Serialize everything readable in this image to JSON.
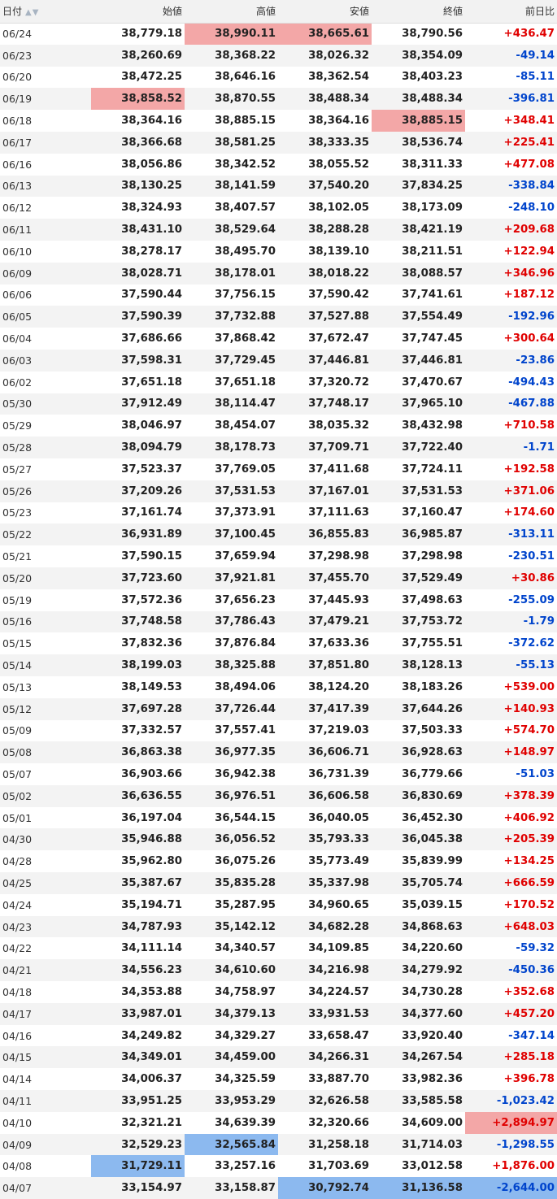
{
  "table": {
    "headers": {
      "date": "日付",
      "open": "始値",
      "high": "高値",
      "low": "安値",
      "close": "終値",
      "change": "前日比"
    },
    "sort_icon": "sort-arrows-icon",
    "rows": [
      {
        "date": "06/24",
        "open": "38,779.18",
        "high": "38,990.11",
        "low": "38,665.61",
        "close": "38,790.56",
        "change": "+436.47",
        "dir": "up",
        "hl": {
          "high": "red",
          "low": "red"
        }
      },
      {
        "date": "06/23",
        "open": "38,260.69",
        "high": "38,368.22",
        "low": "38,026.32",
        "close": "38,354.09",
        "change": "-49.14",
        "dir": "down"
      },
      {
        "date": "06/20",
        "open": "38,472.25",
        "high": "38,646.16",
        "low": "38,362.54",
        "close": "38,403.23",
        "change": "-85.11",
        "dir": "down"
      },
      {
        "date": "06/19",
        "open": "38,858.52",
        "high": "38,870.55",
        "low": "38,488.34",
        "close": "38,488.34",
        "change": "-396.81",
        "dir": "down",
        "hl": {
          "open": "red"
        }
      },
      {
        "date": "06/18",
        "open": "38,364.16",
        "high": "38,885.15",
        "low": "38,364.16",
        "close": "38,885.15",
        "change": "+348.41",
        "dir": "up",
        "hl": {
          "close": "red"
        }
      },
      {
        "date": "06/17",
        "open": "38,366.68",
        "high": "38,581.25",
        "low": "38,333.35",
        "close": "38,536.74",
        "change": "+225.41",
        "dir": "up"
      },
      {
        "date": "06/16",
        "open": "38,056.86",
        "high": "38,342.52",
        "low": "38,055.52",
        "close": "38,311.33",
        "change": "+477.08",
        "dir": "up"
      },
      {
        "date": "06/13",
        "open": "38,130.25",
        "high": "38,141.59",
        "low": "37,540.20",
        "close": "37,834.25",
        "change": "-338.84",
        "dir": "down"
      },
      {
        "date": "06/12",
        "open": "38,324.93",
        "high": "38,407.57",
        "low": "38,102.05",
        "close": "38,173.09",
        "change": "-248.10",
        "dir": "down"
      },
      {
        "date": "06/11",
        "open": "38,431.10",
        "high": "38,529.64",
        "low": "38,288.28",
        "close": "38,421.19",
        "change": "+209.68",
        "dir": "up"
      },
      {
        "date": "06/10",
        "open": "38,278.17",
        "high": "38,495.70",
        "low": "38,139.10",
        "close": "38,211.51",
        "change": "+122.94",
        "dir": "up"
      },
      {
        "date": "06/09",
        "open": "38,028.71",
        "high": "38,178.01",
        "low": "38,018.22",
        "close": "38,088.57",
        "change": "+346.96",
        "dir": "up"
      },
      {
        "date": "06/06",
        "open": "37,590.44",
        "high": "37,756.15",
        "low": "37,590.42",
        "close": "37,741.61",
        "change": "+187.12",
        "dir": "up"
      },
      {
        "date": "06/05",
        "open": "37,590.39",
        "high": "37,732.88",
        "low": "37,527.88",
        "close": "37,554.49",
        "change": "-192.96",
        "dir": "down"
      },
      {
        "date": "06/04",
        "open": "37,686.66",
        "high": "37,868.42",
        "low": "37,672.47",
        "close": "37,747.45",
        "change": "+300.64",
        "dir": "up"
      },
      {
        "date": "06/03",
        "open": "37,598.31",
        "high": "37,729.45",
        "low": "37,446.81",
        "close": "37,446.81",
        "change": "-23.86",
        "dir": "down"
      },
      {
        "date": "06/02",
        "open": "37,651.18",
        "high": "37,651.18",
        "low": "37,320.72",
        "close": "37,470.67",
        "change": "-494.43",
        "dir": "down"
      },
      {
        "date": "05/30",
        "open": "37,912.49",
        "high": "38,114.47",
        "low": "37,748.17",
        "close": "37,965.10",
        "change": "-467.88",
        "dir": "down"
      },
      {
        "date": "05/29",
        "open": "38,046.97",
        "high": "38,454.07",
        "low": "38,035.32",
        "close": "38,432.98",
        "change": "+710.58",
        "dir": "up"
      },
      {
        "date": "05/28",
        "open": "38,094.79",
        "high": "38,178.73",
        "low": "37,709.71",
        "close": "37,722.40",
        "change": "-1.71",
        "dir": "down"
      },
      {
        "date": "05/27",
        "open": "37,523.37",
        "high": "37,769.05",
        "low": "37,411.68",
        "close": "37,724.11",
        "change": "+192.58",
        "dir": "up"
      },
      {
        "date": "05/26",
        "open": "37,209.26",
        "high": "37,531.53",
        "low": "37,167.01",
        "close": "37,531.53",
        "change": "+371.06",
        "dir": "up"
      },
      {
        "date": "05/23",
        "open": "37,161.74",
        "high": "37,373.91",
        "low": "37,111.63",
        "close": "37,160.47",
        "change": "+174.60",
        "dir": "up"
      },
      {
        "date": "05/22",
        "open": "36,931.89",
        "high": "37,100.45",
        "low": "36,855.83",
        "close": "36,985.87",
        "change": "-313.11",
        "dir": "down"
      },
      {
        "date": "05/21",
        "open": "37,590.15",
        "high": "37,659.94",
        "low": "37,298.98",
        "close": "37,298.98",
        "change": "-230.51",
        "dir": "down"
      },
      {
        "date": "05/20",
        "open": "37,723.60",
        "high": "37,921.81",
        "low": "37,455.70",
        "close": "37,529.49",
        "change": "+30.86",
        "dir": "up"
      },
      {
        "date": "05/19",
        "open": "37,572.36",
        "high": "37,656.23",
        "low": "37,445.93",
        "close": "37,498.63",
        "change": "-255.09",
        "dir": "down"
      },
      {
        "date": "05/16",
        "open": "37,748.58",
        "high": "37,786.43",
        "low": "37,479.21",
        "close": "37,753.72",
        "change": "-1.79",
        "dir": "down"
      },
      {
        "date": "05/15",
        "open": "37,832.36",
        "high": "37,876.84",
        "low": "37,633.36",
        "close": "37,755.51",
        "change": "-372.62",
        "dir": "down"
      },
      {
        "date": "05/14",
        "open": "38,199.03",
        "high": "38,325.88",
        "low": "37,851.80",
        "close": "38,128.13",
        "change": "-55.13",
        "dir": "down"
      },
      {
        "date": "05/13",
        "open": "38,149.53",
        "high": "38,494.06",
        "low": "38,124.20",
        "close": "38,183.26",
        "change": "+539.00",
        "dir": "up"
      },
      {
        "date": "05/12",
        "open": "37,697.28",
        "high": "37,726.44",
        "low": "37,417.39",
        "close": "37,644.26",
        "change": "+140.93",
        "dir": "up"
      },
      {
        "date": "05/09",
        "open": "37,332.57",
        "high": "37,557.41",
        "low": "37,219.03",
        "close": "37,503.33",
        "change": "+574.70",
        "dir": "up"
      },
      {
        "date": "05/08",
        "open": "36,863.38",
        "high": "36,977.35",
        "low": "36,606.71",
        "close": "36,928.63",
        "change": "+148.97",
        "dir": "up"
      },
      {
        "date": "05/07",
        "open": "36,903.66",
        "high": "36,942.38",
        "low": "36,731.39",
        "close": "36,779.66",
        "change": "-51.03",
        "dir": "down"
      },
      {
        "date": "05/02",
        "open": "36,636.55",
        "high": "36,976.51",
        "low": "36,606.58",
        "close": "36,830.69",
        "change": "+378.39",
        "dir": "up"
      },
      {
        "date": "05/01",
        "open": "36,197.04",
        "high": "36,544.15",
        "low": "36,040.05",
        "close": "36,452.30",
        "change": "+406.92",
        "dir": "up"
      },
      {
        "date": "04/30",
        "open": "35,946.88",
        "high": "36,056.52",
        "low": "35,793.33",
        "close": "36,045.38",
        "change": "+205.39",
        "dir": "up"
      },
      {
        "date": "04/28",
        "open": "35,962.80",
        "high": "36,075.26",
        "low": "35,773.49",
        "close": "35,839.99",
        "change": "+134.25",
        "dir": "up"
      },
      {
        "date": "04/25",
        "open": "35,387.67",
        "high": "35,835.28",
        "low": "35,337.98",
        "close": "35,705.74",
        "change": "+666.59",
        "dir": "up"
      },
      {
        "date": "04/24",
        "open": "35,194.71",
        "high": "35,287.95",
        "low": "34,960.65",
        "close": "35,039.15",
        "change": "+170.52",
        "dir": "up"
      },
      {
        "date": "04/23",
        "open": "34,787.93",
        "high": "35,142.12",
        "low": "34,682.28",
        "close": "34,868.63",
        "change": "+648.03",
        "dir": "up"
      },
      {
        "date": "04/22",
        "open": "34,111.14",
        "high": "34,340.57",
        "low": "34,109.85",
        "close": "34,220.60",
        "change": "-59.32",
        "dir": "down"
      },
      {
        "date": "04/21",
        "open": "34,556.23",
        "high": "34,610.60",
        "low": "34,216.98",
        "close": "34,279.92",
        "change": "-450.36",
        "dir": "down"
      },
      {
        "date": "04/18",
        "open": "34,353.88",
        "high": "34,758.97",
        "low": "34,224.57",
        "close": "34,730.28",
        "change": "+352.68",
        "dir": "up"
      },
      {
        "date": "04/17",
        "open": "33,987.01",
        "high": "34,379.13",
        "low": "33,931.53",
        "close": "34,377.60",
        "change": "+457.20",
        "dir": "up"
      },
      {
        "date": "04/16",
        "open": "34,249.82",
        "high": "34,329.27",
        "low": "33,658.47",
        "close": "33,920.40",
        "change": "-347.14",
        "dir": "down"
      },
      {
        "date": "04/15",
        "open": "34,349.01",
        "high": "34,459.00",
        "low": "34,266.31",
        "close": "34,267.54",
        "change": "+285.18",
        "dir": "up"
      },
      {
        "date": "04/14",
        "open": "34,006.37",
        "high": "34,325.59",
        "low": "33,887.70",
        "close": "33,982.36",
        "change": "+396.78",
        "dir": "up"
      },
      {
        "date": "04/11",
        "open": "33,951.25",
        "high": "33,953.29",
        "low": "32,626.58",
        "close": "33,585.58",
        "change": "-1,023.42",
        "dir": "down"
      },
      {
        "date": "04/10",
        "open": "32,321.21",
        "high": "34,639.39",
        "low": "32,320.66",
        "close": "34,609.00",
        "change": "+2,894.97",
        "dir": "up",
        "hl": {
          "change": "red"
        }
      },
      {
        "date": "04/09",
        "open": "32,529.23",
        "high": "32,565.84",
        "low": "31,258.18",
        "close": "31,714.03",
        "change": "-1,298.55",
        "dir": "down",
        "hl": {
          "high": "blue"
        }
      },
      {
        "date": "04/08",
        "open": "31,729.11",
        "high": "33,257.16",
        "low": "31,703.69",
        "close": "33,012.58",
        "change": "+1,876.00",
        "dir": "up",
        "hl": {
          "open": "blue"
        }
      },
      {
        "date": "04/07",
        "open": "33,154.97",
        "high": "33,158.87",
        "low": "30,792.74",
        "close": "31,136.58",
        "change": "-2,644.00",
        "dir": "down",
        "hl": {
          "low": "blue",
          "close": "blue",
          "change": "blue"
        }
      }
    ],
    "colors": {
      "up": "#e00000",
      "down": "#0044cc",
      "highlight_red": "#f3a7a7",
      "highlight_blue": "#8cb9ef"
    }
  }
}
